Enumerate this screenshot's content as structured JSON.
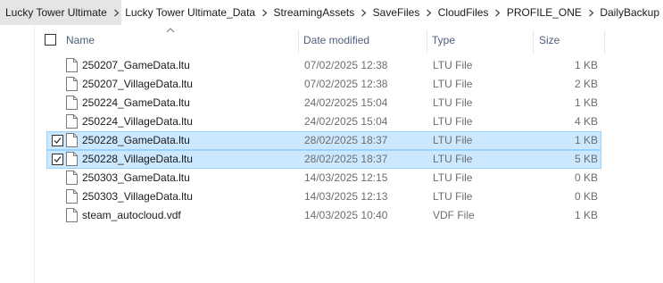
{
  "breadcrumb": {
    "items": [
      "Lucky Tower Ultimate",
      "Lucky Tower Ultimate_Data",
      "StreamingAssets",
      "SaveFiles",
      "CloudFiles",
      "PROFILE_ONE",
      "DailyBackup"
    ]
  },
  "header": {
    "name": "Name",
    "date_modified": "Date modified",
    "type": "Type",
    "size": "Size"
  },
  "files": [
    {
      "name": "250207_GameData.ltu",
      "date": "07/02/2025 12:38",
      "type": "LTU File",
      "size": "1 KB",
      "selected": false
    },
    {
      "name": "250207_VillageData.ltu",
      "date": "07/02/2025 12:38",
      "type": "LTU File",
      "size": "2 KB",
      "selected": false
    },
    {
      "name": "250224_GameData.ltu",
      "date": "24/02/2025 15:04",
      "type": "LTU File",
      "size": "1 KB",
      "selected": false
    },
    {
      "name": "250224_VillageData.ltu",
      "date": "24/02/2025 15:04",
      "type": "LTU File",
      "size": "4 KB",
      "selected": false
    },
    {
      "name": "250228_GameData.ltu",
      "date": "28/02/2025 18:37",
      "type": "LTU File",
      "size": "1 KB",
      "selected": true
    },
    {
      "name": "250228_VillageData.ltu",
      "date": "28/02/2025 18:37",
      "type": "LTU File",
      "size": "5 KB",
      "selected": true
    },
    {
      "name": "250303_GameData.ltu",
      "date": "14/03/2025 12:15",
      "type": "LTU File",
      "size": "0 KB",
      "selected": false
    },
    {
      "name": "250303_VillageData.ltu",
      "date": "14/03/2025 12:13",
      "type": "LTU File",
      "size": "0 KB",
      "selected": false
    },
    {
      "name": "steam_autocloud.vdf",
      "date": "14/03/2025 10:40",
      "type": "VDF File",
      "size": "1 KB",
      "selected": false
    }
  ],
  "colors": {
    "selection_bg": "#cce8ff",
    "selection_border": "#99d1ff",
    "header_text": "#4c607a"
  },
  "icons": {
    "breadcrumb_separator": "chevron-right-icon",
    "file": "file-icon",
    "checkbox": "checkbox-icon",
    "sort": "sort-up-icon"
  }
}
